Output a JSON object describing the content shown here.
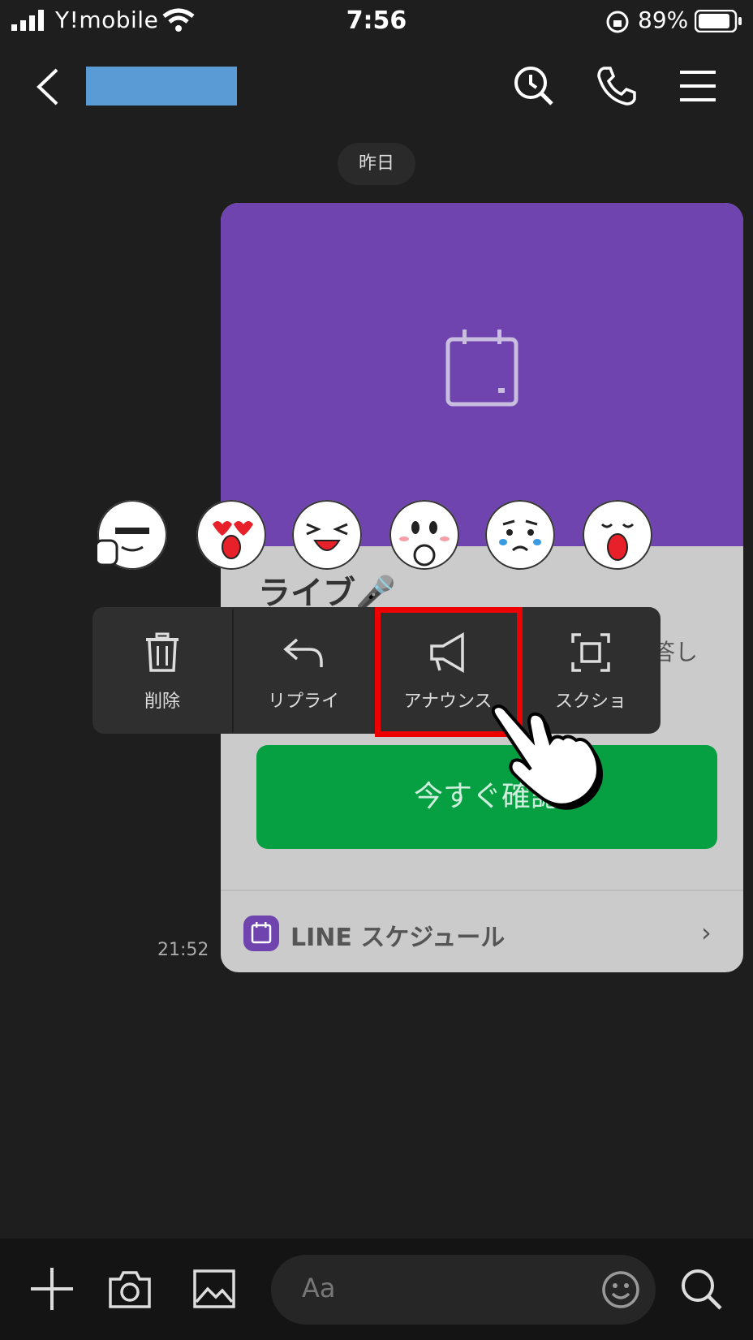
{
  "status_bar": {
    "carrier": "Y!mobile",
    "time": "7:56",
    "battery": "89%"
  },
  "header": {
    "back_icon": "chevron-left-icon",
    "contact_name": "",
    "icons": [
      "search-clock-icon",
      "phone-icon",
      "menu-icon"
    ]
  },
  "chat": {
    "date_label": "昨日",
    "message": {
      "title": "ライブ🎤",
      "partial_text": "答し",
      "confirm_button": "今すぐ確認",
      "footer_label": "LINE スケジュール",
      "time": "21:52"
    }
  },
  "reactions": [
    "thumbs-up-face-icon",
    "heart-eyes-face-icon",
    "laughing-face-icon",
    "touched-face-icon",
    "crying-face-icon",
    "surprised-face-icon"
  ],
  "action_menu": {
    "items": [
      {
        "label": "削除",
        "icon": "trash-icon"
      },
      {
        "label": "リプライ",
        "icon": "reply-icon"
      },
      {
        "label": "アナウンス",
        "icon": "megaphone-icon"
      },
      {
        "label": "スクショ",
        "icon": "screenshot-icon"
      }
    ],
    "highlight_color": "#e00000"
  },
  "input_bar": {
    "placeholder": "Aa"
  },
  "colors": {
    "card_header": "#7044ae",
    "confirm_button": "#06a042",
    "background": "#1e1e1e"
  }
}
